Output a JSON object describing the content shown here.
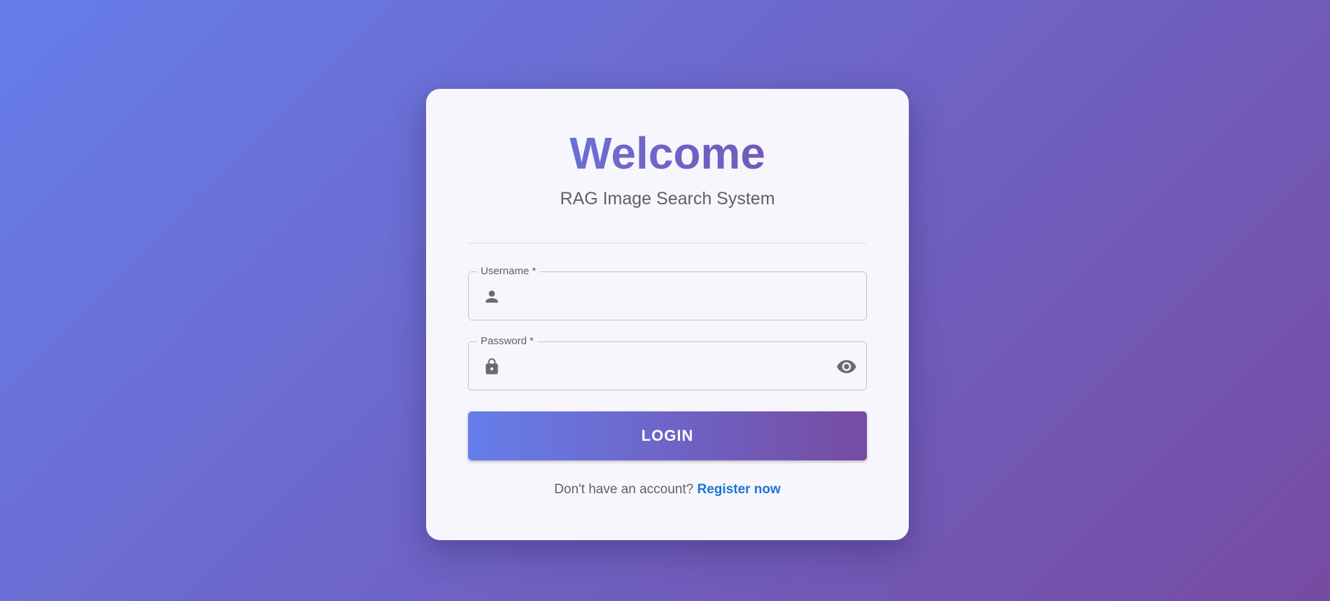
{
  "theme": {
    "gradient_start": "#667eea",
    "gradient_end": "#764ba2",
    "link_color": "#1976d2"
  },
  "login_card": {
    "title": "Welcome",
    "subtitle": "RAG Image Search System",
    "username": {
      "label": "Username *",
      "value": "",
      "icon": "person-icon"
    },
    "password": {
      "label": "Password *",
      "value": "",
      "icon": "lock-icon",
      "toggle_icon": "eye-icon"
    },
    "login_button_label": "LOGIN",
    "register_prompt": "Don't have an account?",
    "register_link": "Register now"
  }
}
